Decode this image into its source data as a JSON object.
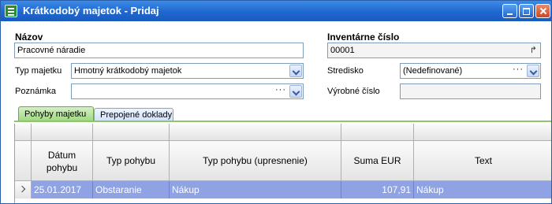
{
  "window": {
    "title": "Krátkodobý majetok - Pridaj"
  },
  "form": {
    "nazov_label": "Názov",
    "nazov_value": "Pracovné náradie",
    "inventarne_label": "Inventárne číslo",
    "inventarne_value": "00001",
    "typ_label": "Typ majetku",
    "typ_value": "Hmotný krátkodobý majetok",
    "stredisko_label": "Stredisko",
    "stredisko_value": "(Nedefinované)",
    "poznamka_label": "Poznámka",
    "poznamka_value": "",
    "vyrobne_label": "Výrobné číslo",
    "vyrobne_value": "",
    "ellipsis": "···"
  },
  "tabs": [
    {
      "label": "Pohyby majetku",
      "active": true
    },
    {
      "label": "Prepojené doklady",
      "active": false
    }
  ],
  "grid": {
    "columns": [
      "Dátum pohybu",
      "Typ pohybu",
      "Typ pohybu (upresnenie)",
      "Suma EUR",
      "Text"
    ],
    "rows": [
      {
        "datum": "25.01.2017",
        "typ": "Obstaranie",
        "upresnenie": "Nákup",
        "suma": "107,91",
        "text": "Nákup"
      }
    ]
  },
  "colors": {
    "title_bar": "#1f67cf",
    "selected_row": "#8fa2e3",
    "active_tab": "#9cd67c"
  }
}
